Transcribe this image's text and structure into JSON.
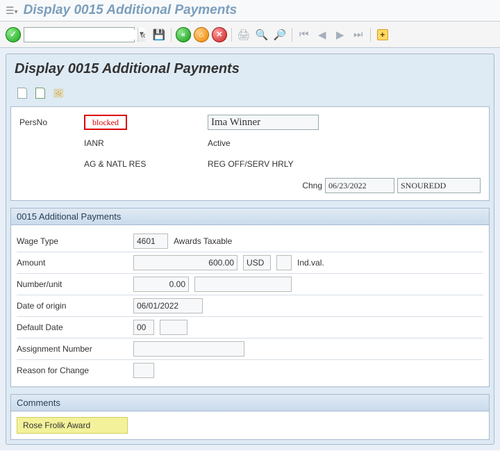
{
  "appTitle": "Display 0015 Additional Payments",
  "panelTitle": "Display 0015 Additional Payments",
  "header": {
    "persNoLabel": "PersNo",
    "blockedText": "blocked",
    "personName": "Ima Winner",
    "org1": "IANR",
    "status": "Active",
    "org2": "AG & NATL RES",
    "position": "REG OFF/SERV HRLY",
    "chngLabel": "Chng",
    "chngDate": "06/23/2022",
    "chngUser": "SNOUREDD"
  },
  "sectionTitle": "0015 Additional Payments",
  "fields": {
    "wageTypeLabel": "Wage Type",
    "wageTypeCode": "4601",
    "wageTypeText": "Awards Taxable",
    "amountLabel": "Amount",
    "amountValue": "600.00",
    "currency": "USD",
    "indVal": "Ind.val.",
    "numberUnitLabel": "Number/unit",
    "numberUnitValue": "0.00",
    "dateOriginLabel": "Date of origin",
    "dateOriginValue": "06/01/2022",
    "defaultDateLabel": "Default Date",
    "defaultDateValue": "00",
    "assignmentLabel": "Assignment Number",
    "assignmentValue": "",
    "reasonLabel": "Reason for Change",
    "reasonValue": ""
  },
  "commentsTitle": "Comments",
  "commentText": "Rose Frolik Award"
}
